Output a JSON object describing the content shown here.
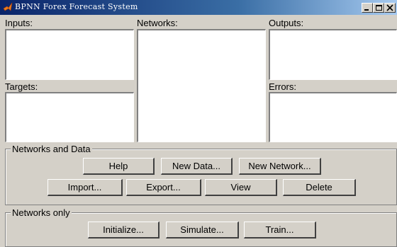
{
  "window": {
    "title": "BPNN Forex Forecast System",
    "icon": "matlab-logo-icon"
  },
  "panels": {
    "inputs_label": "Inputs:",
    "targets_label": "Targets:",
    "networks_label": "Networks:",
    "outputs_label": "Outputs:",
    "errors_label": "Errors:"
  },
  "networks_and_data": {
    "label": "Networks and Data",
    "help": "Help",
    "new_data": "New Data...",
    "new_network": "New Network...",
    "import": "Import...",
    "export": "Export...",
    "view": "View",
    "delete": "Delete"
  },
  "networks_only": {
    "label": "Networks only",
    "initialize": "Initialize...",
    "simulate": "Simulate...",
    "train": "Train..."
  }
}
